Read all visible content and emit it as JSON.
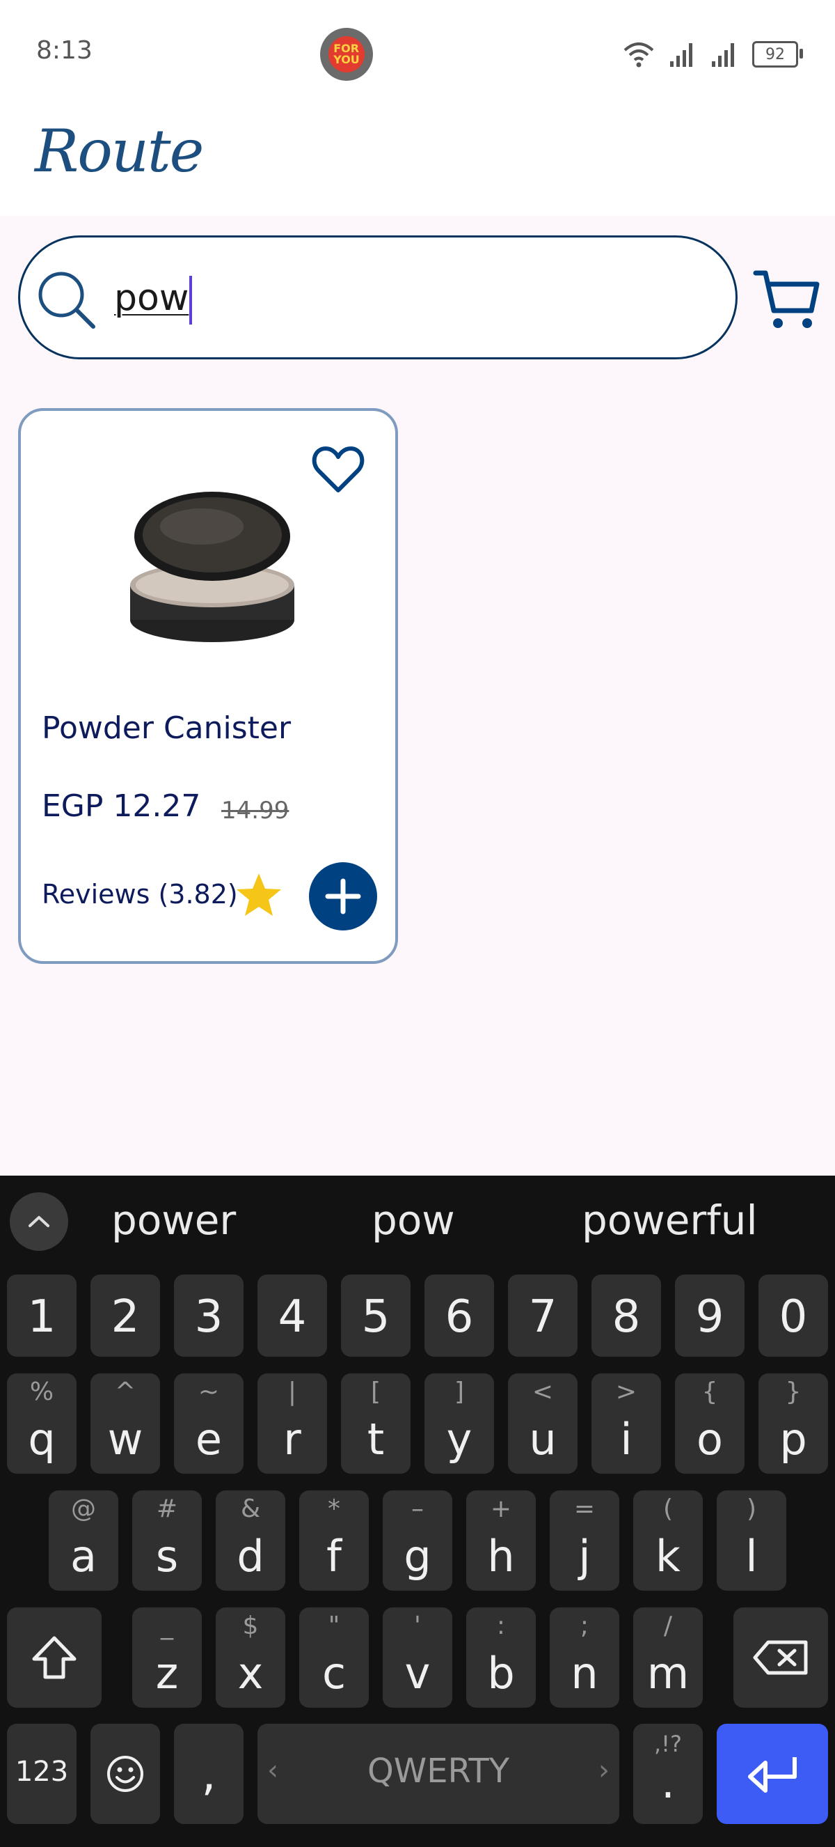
{
  "status_bar": {
    "time": "8:13",
    "battery": "92"
  },
  "header": {
    "logo_text": "Route"
  },
  "search": {
    "query": "pow"
  },
  "product": {
    "name": "Powder Canister",
    "price": "EGP 12.27",
    "old_price": "14.99",
    "reviews": "Reviews (3.82)"
  },
  "keyboard": {
    "suggestions": [
      "power",
      "pow",
      "powerful"
    ],
    "number_row": [
      "1",
      "2",
      "3",
      "4",
      "5",
      "6",
      "7",
      "8",
      "9",
      "0"
    ],
    "row1": [
      {
        "main": "q",
        "sub": "%"
      },
      {
        "main": "w",
        "sub": "^"
      },
      {
        "main": "e",
        "sub": "~"
      },
      {
        "main": "r",
        "sub": "|"
      },
      {
        "main": "t",
        "sub": "["
      },
      {
        "main": "y",
        "sub": "]"
      },
      {
        "main": "u",
        "sub": "<"
      },
      {
        "main": "i",
        "sub": ">"
      },
      {
        "main": "o",
        "sub": "{"
      },
      {
        "main": "p",
        "sub": "}"
      }
    ],
    "row2": [
      {
        "main": "a",
        "sub": "@"
      },
      {
        "main": "s",
        "sub": "#"
      },
      {
        "main": "d",
        "sub": "&"
      },
      {
        "main": "f",
        "sub": "*"
      },
      {
        "main": "g",
        "sub": "–"
      },
      {
        "main": "h",
        "sub": "+"
      },
      {
        "main": "j",
        "sub": "="
      },
      {
        "main": "k",
        "sub": "("
      },
      {
        "main": "l",
        "sub": ")"
      }
    ],
    "row3": [
      {
        "main": "z",
        "sub": "_"
      },
      {
        "main": "x",
        "sub": "$"
      },
      {
        "main": "c",
        "sub": "\""
      },
      {
        "main": "v",
        "sub": "'"
      },
      {
        "main": "b",
        "sub": ":"
      },
      {
        "main": "n",
        "sub": ";"
      },
      {
        "main": "m",
        "sub": "/"
      }
    ],
    "mode_key": "123",
    "comma_key": ",",
    "space_label": "QWERTY",
    "period_key": ".",
    "period_sub": ",!?"
  },
  "colors": {
    "accent": "#004182",
    "enter": "#3c5cf5",
    "star": "#f5c518"
  }
}
